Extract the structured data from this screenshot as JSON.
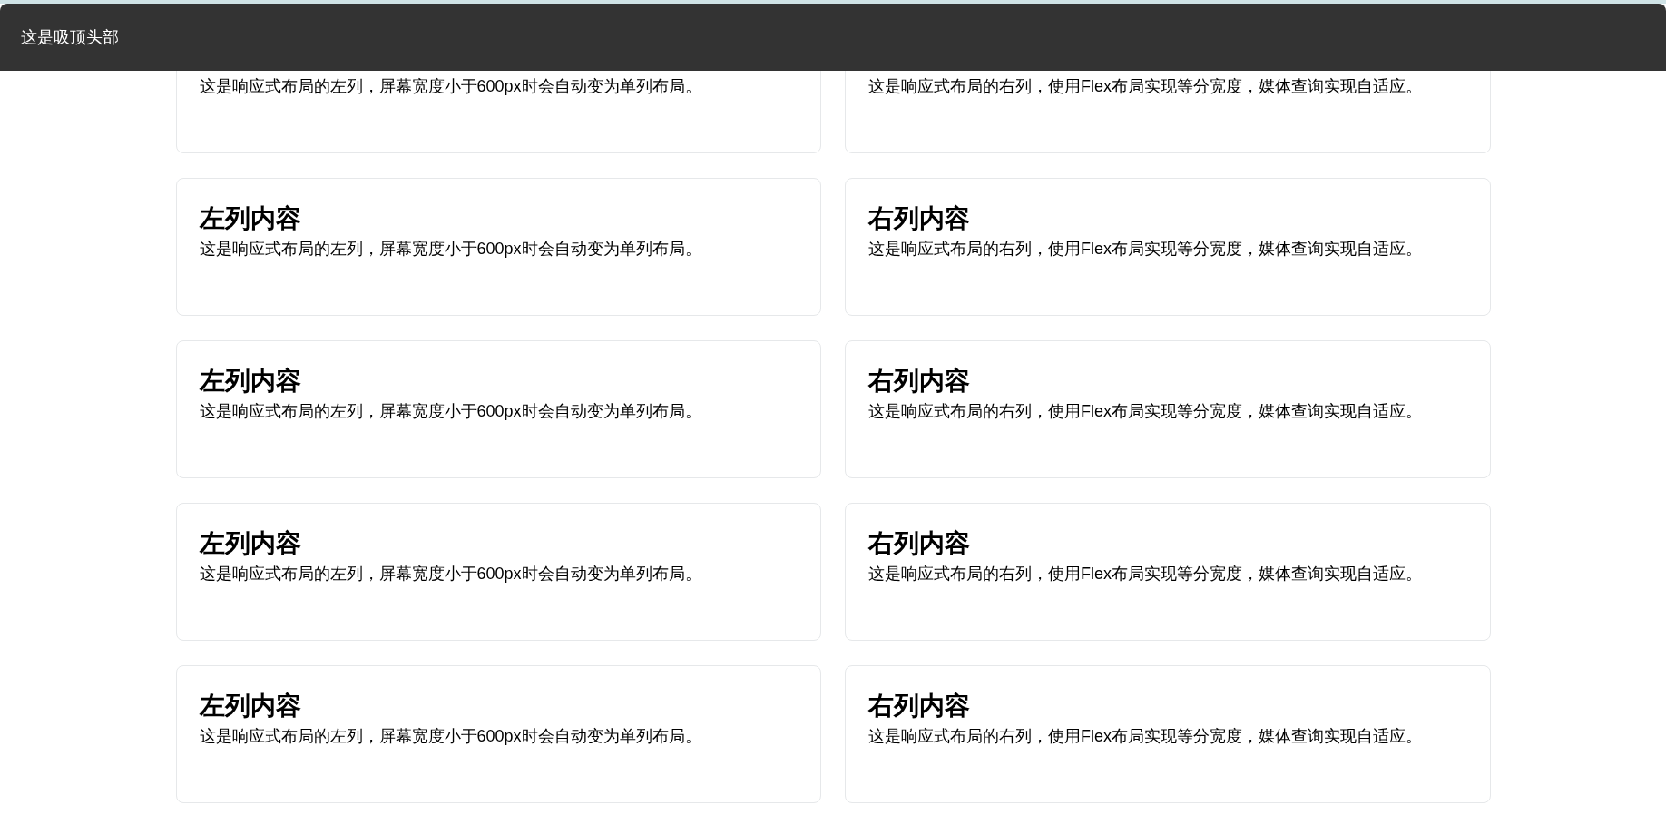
{
  "header": {
    "title": "这是吸顶头部"
  },
  "rows": [
    {
      "left": {
        "text": "这是响应式布局的左列，屏幕宽度小于600px时会自动变为单列布局。"
      },
      "right": {
        "text": "这是响应式布局的右列，使用Flex布局实现等分宽度，媒体查询实现自适应。"
      }
    },
    {
      "left": {
        "title": "左列内容",
        "text": "这是响应式布局的左列，屏幕宽度小于600px时会自动变为单列布局。"
      },
      "right": {
        "title": "右列内容",
        "text": "这是响应式布局的右列，使用Flex布局实现等分宽度，媒体查询实现自适应。"
      }
    },
    {
      "left": {
        "title": "左列内容",
        "text": "这是响应式布局的左列，屏幕宽度小于600px时会自动变为单列布局。"
      },
      "right": {
        "title": "右列内容",
        "text": "这是响应式布局的右列，使用Flex布局实现等分宽度，媒体查询实现自适应。"
      }
    },
    {
      "left": {
        "title": "左列内容",
        "text": "这是响应式布局的左列，屏幕宽度小于600px时会自动变为单列布局。"
      },
      "right": {
        "title": "右列内容",
        "text": "这是响应式布局的右列，使用Flex布局实现等分宽度，媒体查询实现自适应。"
      }
    },
    {
      "left": {
        "title": "左列内容",
        "text": "这是响应式布局的左列，屏幕宽度小于600px时会自动变为单列布局。"
      },
      "right": {
        "title": "右列内容",
        "text": "这是响应式布局的右列，使用Flex布局实现等分宽度，媒体查询实现自适应。"
      }
    }
  ]
}
